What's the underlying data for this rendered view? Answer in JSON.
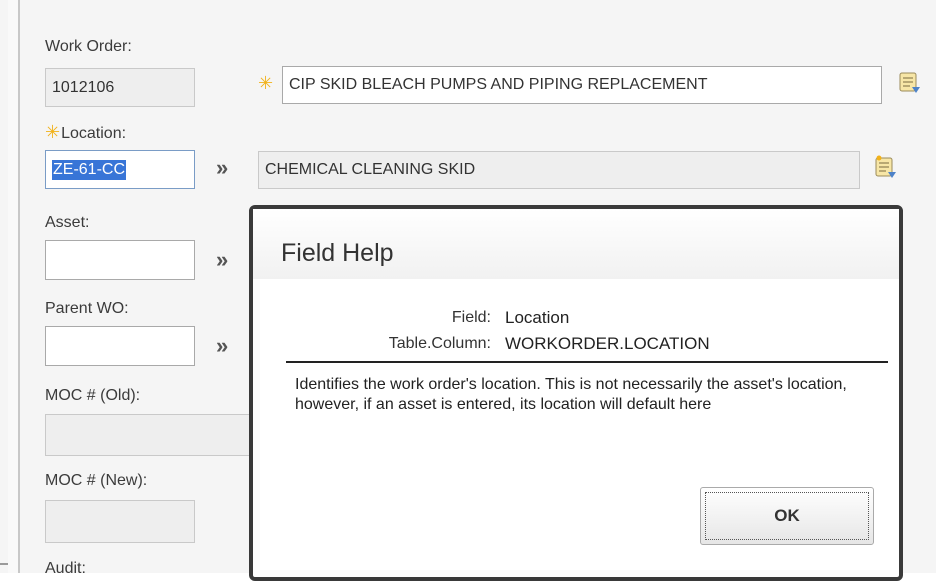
{
  "form": {
    "work_order_label": "Work Order:",
    "work_order_value": "1012106",
    "description_value": "CIP SKID BLEACH PUMPS AND PIPING REPLACEMENT",
    "location_label": "Location:",
    "location_value": "ZE-61-CC",
    "location_description": "CHEMICAL CLEANING SKID",
    "asset_label": "Asset:",
    "parent_wo_label": "Parent WO:",
    "moc_old_label": "MOC # (Old):",
    "moc_new_label": "MOC # (New):",
    "audit_label": "Audit:",
    "required_marker": "✳",
    "lookup_arrow": "»"
  },
  "dialog": {
    "title": "Field Help",
    "field_key": "Field:",
    "field_value": "Location",
    "column_key": "Table.Column:",
    "column_value": "WORKORDER.LOCATION",
    "description": "Identifies the work order's location. This is not necessarily the asset's location, however, if an asset is entered, its location will default here",
    "ok_label": "OK"
  },
  "icons": {
    "detail_lookup": "detail-menu-icon",
    "required": "required-asterisk-icon",
    "lookup_chevron": "double-chevron-icon"
  },
  "colors": {
    "required": "#f2b21a",
    "selection": "#3875d7",
    "dialog_border": "#3a3a3a"
  }
}
